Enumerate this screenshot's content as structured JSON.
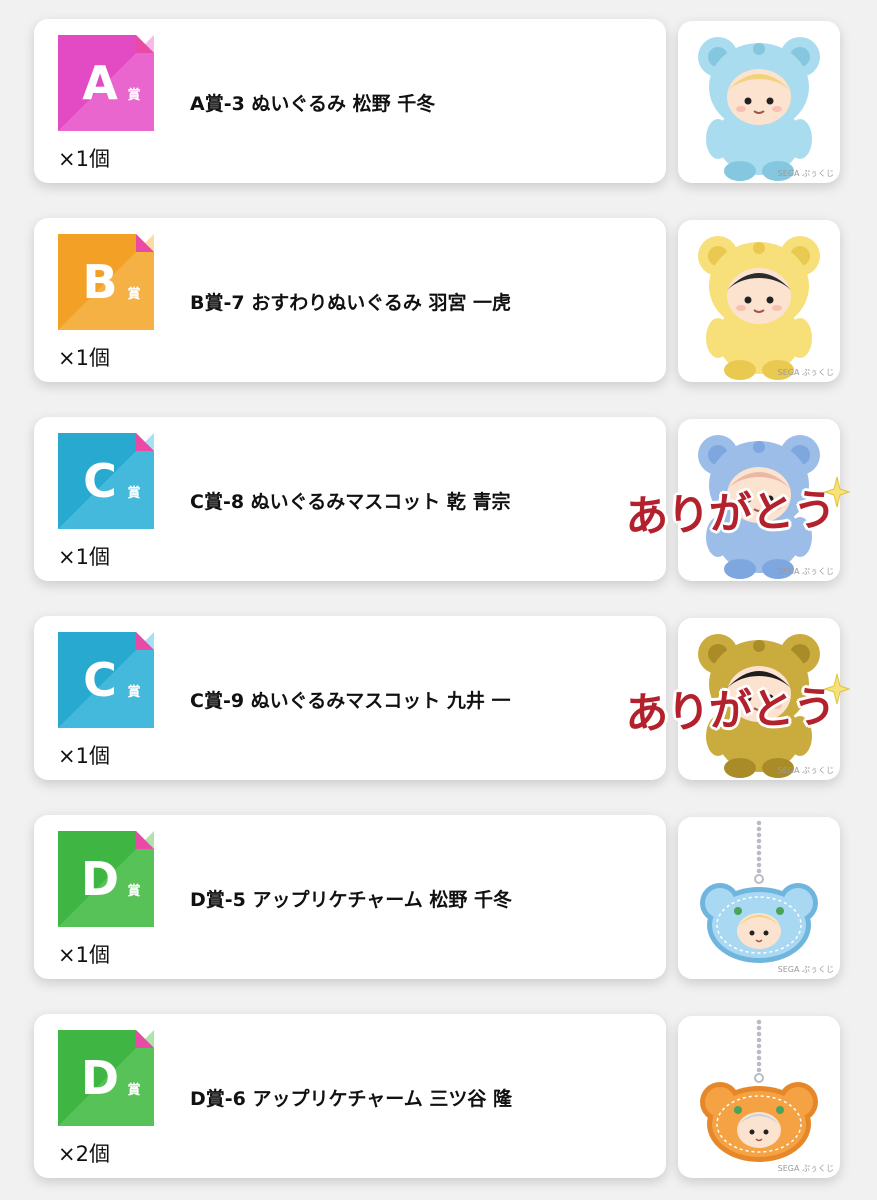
{
  "prizes": [
    {
      "grade": "A",
      "grade_suffix": "賞",
      "name": "A賞-3 ぬいぐるみ 松野 千冬",
      "quantity": "×1個",
      "badge_color": "#e34bc4",
      "badge_color_light": "#f07ed8",
      "plush_color": "#a9dcee",
      "plush_dark": "#84c7df",
      "face_hair": "#f2d27a",
      "item_type": "plush-bear",
      "watermark": "SEGA ぷぅくじ"
    },
    {
      "grade": "B",
      "grade_suffix": "賞",
      "name": "B賞-7 おすわりぬいぐるみ 羽宮 一虎",
      "quantity": "×1個",
      "badge_color": "#f2a126",
      "badge_color_light": "#f8bf5d",
      "plush_color": "#f7e07a",
      "plush_dark": "#e9c94f",
      "face_hair": "#2b2b2b",
      "item_type": "plush-bear",
      "watermark": "SEGA ぷぅくじ"
    },
    {
      "grade": "C",
      "grade_suffix": "賞",
      "name": "C賞-8 ぬいぐるみマスコット 乾 青宗",
      "quantity": "×1個",
      "badge_color": "#27a9d0",
      "badge_color_light": "#5cc6e6",
      "plush_color": "#9bbde8",
      "plush_dark": "#7ea6df",
      "face_hair": "#e9b9a4",
      "item_type": "plush-bear",
      "watermark": "SEGA ぷぅくじ",
      "sticker": "ありがとう"
    },
    {
      "grade": "C",
      "grade_suffix": "賞",
      "name": "C賞-9 ぬいぐるみマスコット 九井 一",
      "quantity": "×1個",
      "badge_color": "#27a9d0",
      "badge_color_light": "#5cc6e6",
      "plush_color": "#c9ab3e",
      "plush_dark": "#a98c28",
      "face_hair": "#1e1e1e",
      "item_type": "plush-bear",
      "watermark": "SEGA ぷぅくじ",
      "sticker": "ありがとう"
    },
    {
      "grade": "D",
      "grade_suffix": "賞",
      "name": "D賞-5 アップリケチャーム 松野 千冬",
      "quantity": "×1個",
      "badge_color": "#3fb544",
      "badge_color_light": "#6ccc68",
      "plush_color": "#a9d8f2",
      "plush_dark": "#6fb5de",
      "face_hair": "#f2d27a",
      "item_type": "charm",
      "watermark": "SEGA ぷぅくじ"
    },
    {
      "grade": "D",
      "grade_suffix": "賞",
      "name": "D賞-6 アップリケチャーム 三ツ谷 隆",
      "quantity": "×2個",
      "badge_color": "#3fb544",
      "badge_color_light": "#6ccc68",
      "plush_color": "#f4a243",
      "plush_dark": "#e6872a",
      "face_hair": "#bcd3ea",
      "item_type": "charm",
      "watermark": "SEGA ぷぅくじ"
    }
  ]
}
